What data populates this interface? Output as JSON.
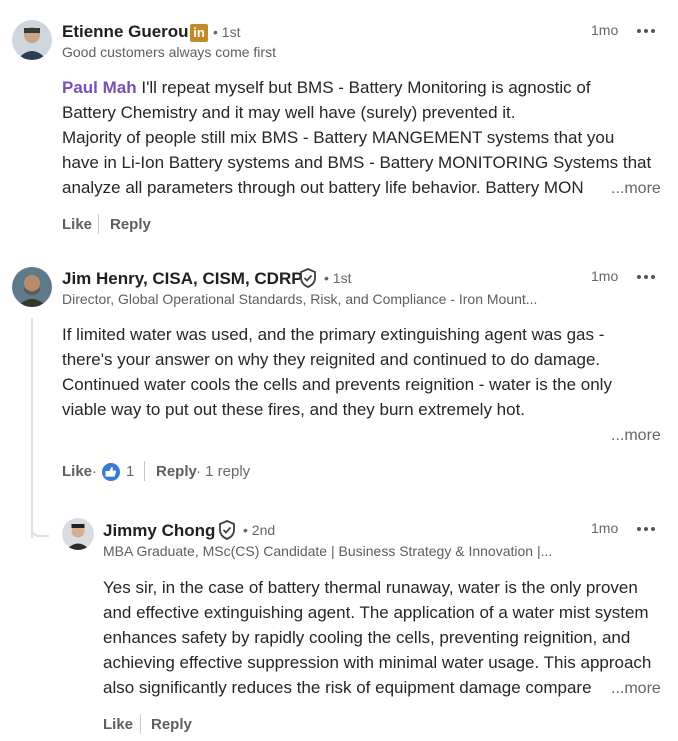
{
  "comments": [
    {
      "author": "Etienne Guerou",
      "badge_icon": "linkedin-premium-icon",
      "degree": "• 1st",
      "headline": "Good customers always come first",
      "time": "1mo",
      "mention": "Paul Mah",
      "lines": [
        " I'll repeat myself but BMS - Battery Monitoring is agnostic of",
        "Battery Chemistry and it may well have (surely) prevented it.",
        "Majority of people still mix BMS - Battery MANGEMENT systems that you",
        "have in Li-Ion Battery systems and BMS - Battery MONITORING Systems that",
        "analyze all parameters through out battery life behavior. Battery MON"
      ],
      "more": "...more",
      "like": "Like",
      "reply": "Reply"
    },
    {
      "author": "Jim Henry, CISA, CISM, CDRP",
      "verified_icon": "verified-shield-icon",
      "degree": "• 1st",
      "headline": "Director, Global Operational Standards, Risk, and Compliance - Iron Mount...",
      "time": "1mo",
      "lines": [
        "If limited water was used, and the primary extinguishing agent was gas -",
        "there's your answer on why they reignited and continued to do damage.",
        "Continued water cools the cells and prevents reignition - water is the only",
        "viable way to put out these fires, and they burn extremely hot."
      ],
      "more": "...more",
      "like": "Like",
      "reaction_icon": "thumbs-up-reaction-icon",
      "reaction_count": "1",
      "reply": "Reply",
      "replies_meta": "· 1 reply"
    },
    {
      "author": "Jimmy Chong",
      "verified_icon": "verified-shield-icon",
      "degree": "• 2nd",
      "headline": "MBA Graduate, MSc(CS) Candidate | Business Strategy & Innovation |...",
      "time": "1mo",
      "lines": [
        "Yes sir, in the case of battery thermal runaway, water is the only proven",
        "and effective extinguishing agent. The application of a water mist system",
        "enhances safety by rapidly cooling the cells, preventing reignition, and",
        "achieving effective suppression with minimal water usage. This approach",
        "also significantly reduces the risk of equipment damage compare"
      ],
      "more": "...more",
      "like": "Like",
      "reply": "Reply"
    }
  ],
  "colors": {
    "mention": "#7b4fb5",
    "premium_badge": "#c28a2b",
    "reaction": "#3b78d8"
  }
}
